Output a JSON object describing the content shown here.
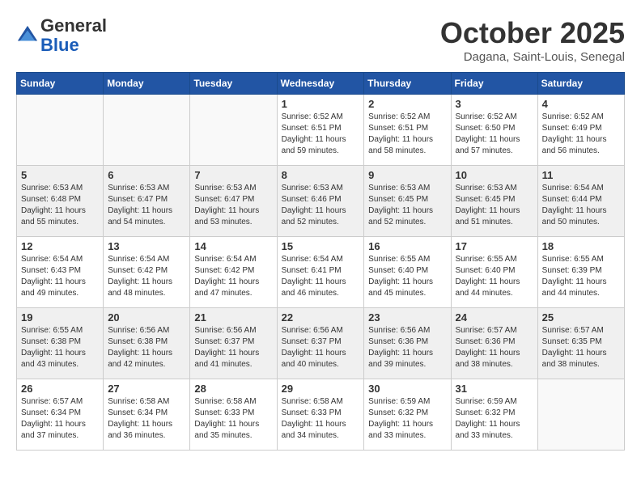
{
  "header": {
    "logo_general": "General",
    "logo_blue": "Blue",
    "month": "October 2025",
    "location": "Dagana, Saint-Louis, Senegal"
  },
  "days_of_week": [
    "Sunday",
    "Monday",
    "Tuesday",
    "Wednesday",
    "Thursday",
    "Friday",
    "Saturday"
  ],
  "weeks": [
    [
      {
        "day": "",
        "info": ""
      },
      {
        "day": "",
        "info": ""
      },
      {
        "day": "",
        "info": ""
      },
      {
        "day": "1",
        "info": "Sunrise: 6:52 AM\nSunset: 6:51 PM\nDaylight: 11 hours and 59 minutes."
      },
      {
        "day": "2",
        "info": "Sunrise: 6:52 AM\nSunset: 6:51 PM\nDaylight: 11 hours and 58 minutes."
      },
      {
        "day": "3",
        "info": "Sunrise: 6:52 AM\nSunset: 6:50 PM\nDaylight: 11 hours and 57 minutes."
      },
      {
        "day": "4",
        "info": "Sunrise: 6:52 AM\nSunset: 6:49 PM\nDaylight: 11 hours and 56 minutes."
      }
    ],
    [
      {
        "day": "5",
        "info": "Sunrise: 6:53 AM\nSunset: 6:48 PM\nDaylight: 11 hours and 55 minutes."
      },
      {
        "day": "6",
        "info": "Sunrise: 6:53 AM\nSunset: 6:47 PM\nDaylight: 11 hours and 54 minutes."
      },
      {
        "day": "7",
        "info": "Sunrise: 6:53 AM\nSunset: 6:47 PM\nDaylight: 11 hours and 53 minutes."
      },
      {
        "day": "8",
        "info": "Sunrise: 6:53 AM\nSunset: 6:46 PM\nDaylight: 11 hours and 52 minutes."
      },
      {
        "day": "9",
        "info": "Sunrise: 6:53 AM\nSunset: 6:45 PM\nDaylight: 11 hours and 52 minutes."
      },
      {
        "day": "10",
        "info": "Sunrise: 6:53 AM\nSunset: 6:45 PM\nDaylight: 11 hours and 51 minutes."
      },
      {
        "day": "11",
        "info": "Sunrise: 6:54 AM\nSunset: 6:44 PM\nDaylight: 11 hours and 50 minutes."
      }
    ],
    [
      {
        "day": "12",
        "info": "Sunrise: 6:54 AM\nSunset: 6:43 PM\nDaylight: 11 hours and 49 minutes."
      },
      {
        "day": "13",
        "info": "Sunrise: 6:54 AM\nSunset: 6:42 PM\nDaylight: 11 hours and 48 minutes."
      },
      {
        "day": "14",
        "info": "Sunrise: 6:54 AM\nSunset: 6:42 PM\nDaylight: 11 hours and 47 minutes."
      },
      {
        "day": "15",
        "info": "Sunrise: 6:54 AM\nSunset: 6:41 PM\nDaylight: 11 hours and 46 minutes."
      },
      {
        "day": "16",
        "info": "Sunrise: 6:55 AM\nSunset: 6:40 PM\nDaylight: 11 hours and 45 minutes."
      },
      {
        "day": "17",
        "info": "Sunrise: 6:55 AM\nSunset: 6:40 PM\nDaylight: 11 hours and 44 minutes."
      },
      {
        "day": "18",
        "info": "Sunrise: 6:55 AM\nSunset: 6:39 PM\nDaylight: 11 hours and 44 minutes."
      }
    ],
    [
      {
        "day": "19",
        "info": "Sunrise: 6:55 AM\nSunset: 6:38 PM\nDaylight: 11 hours and 43 minutes."
      },
      {
        "day": "20",
        "info": "Sunrise: 6:56 AM\nSunset: 6:38 PM\nDaylight: 11 hours and 42 minutes."
      },
      {
        "day": "21",
        "info": "Sunrise: 6:56 AM\nSunset: 6:37 PM\nDaylight: 11 hours and 41 minutes."
      },
      {
        "day": "22",
        "info": "Sunrise: 6:56 AM\nSunset: 6:37 PM\nDaylight: 11 hours and 40 minutes."
      },
      {
        "day": "23",
        "info": "Sunrise: 6:56 AM\nSunset: 6:36 PM\nDaylight: 11 hours and 39 minutes."
      },
      {
        "day": "24",
        "info": "Sunrise: 6:57 AM\nSunset: 6:36 PM\nDaylight: 11 hours and 38 minutes."
      },
      {
        "day": "25",
        "info": "Sunrise: 6:57 AM\nSunset: 6:35 PM\nDaylight: 11 hours and 38 minutes."
      }
    ],
    [
      {
        "day": "26",
        "info": "Sunrise: 6:57 AM\nSunset: 6:34 PM\nDaylight: 11 hours and 37 minutes."
      },
      {
        "day": "27",
        "info": "Sunrise: 6:58 AM\nSunset: 6:34 PM\nDaylight: 11 hours and 36 minutes."
      },
      {
        "day": "28",
        "info": "Sunrise: 6:58 AM\nSunset: 6:33 PM\nDaylight: 11 hours and 35 minutes."
      },
      {
        "day": "29",
        "info": "Sunrise: 6:58 AM\nSunset: 6:33 PM\nDaylight: 11 hours and 34 minutes."
      },
      {
        "day": "30",
        "info": "Sunrise: 6:59 AM\nSunset: 6:32 PM\nDaylight: 11 hours and 33 minutes."
      },
      {
        "day": "31",
        "info": "Sunrise: 6:59 AM\nSunset: 6:32 PM\nDaylight: 11 hours and 33 minutes."
      },
      {
        "day": "",
        "info": ""
      }
    ]
  ]
}
